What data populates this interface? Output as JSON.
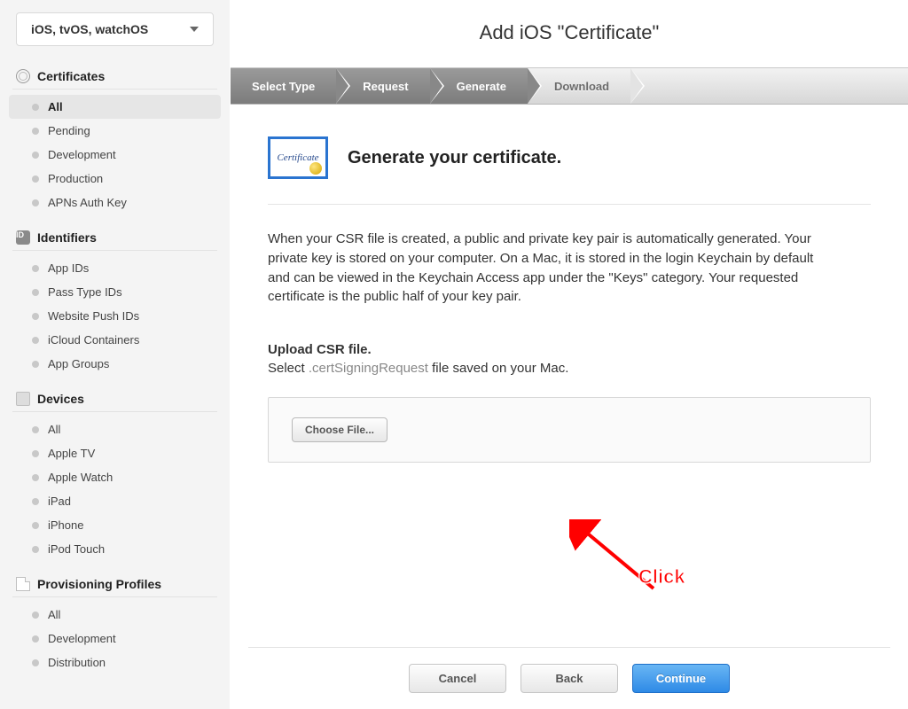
{
  "platform_selector": {
    "label": "iOS, tvOS, watchOS"
  },
  "sidebar": [
    {
      "title": "Certificates",
      "icon": "cert",
      "items": [
        {
          "label": "All",
          "active": true
        },
        {
          "label": "Pending"
        },
        {
          "label": "Development"
        },
        {
          "label": "Production"
        },
        {
          "label": "APNs Auth Key"
        }
      ]
    },
    {
      "title": "Identifiers",
      "icon": "id",
      "items": [
        {
          "label": "App IDs"
        },
        {
          "label": "Pass Type IDs"
        },
        {
          "label": "Website Push IDs"
        },
        {
          "label": "iCloud Containers"
        },
        {
          "label": "App Groups"
        }
      ]
    },
    {
      "title": "Devices",
      "icon": "dev",
      "items": [
        {
          "label": "All"
        },
        {
          "label": "Apple TV"
        },
        {
          "label": "Apple Watch"
        },
        {
          "label": "iPad"
        },
        {
          "label": "iPhone"
        },
        {
          "label": "iPod Touch"
        }
      ]
    },
    {
      "title": "Provisioning Profiles",
      "icon": "prov",
      "items": [
        {
          "label": "All"
        },
        {
          "label": "Development"
        },
        {
          "label": "Distribution"
        }
      ]
    }
  ],
  "page": {
    "title": "Add iOS \"Certificate\"",
    "steps": [
      {
        "label": "Select Type",
        "active": true
      },
      {
        "label": "Request",
        "active": true
      },
      {
        "label": "Generate",
        "active": true
      },
      {
        "label": "Download",
        "active": false
      }
    ],
    "cert_icon_word": "Certificate",
    "heading": "Generate your certificate.",
    "description": "When your CSR file is created, a public and private key pair is automatically generated. Your private key is stored on your computer. On a Mac, it is stored in the login Keychain by default and can be viewed in the Keychain Access app under the \"Keys\" category. Your requested certificate is the public half of your key pair.",
    "upload_heading": "Upload CSR file.",
    "upload_sub_pre": "Select ",
    "upload_sub_code": ".certSigningRequest",
    "upload_sub_post": " file saved on your Mac.",
    "choose_file_label": "Choose File...",
    "annotation_label": "Click",
    "buttons": {
      "cancel": "Cancel",
      "back": "Back",
      "continue": "Continue"
    }
  }
}
